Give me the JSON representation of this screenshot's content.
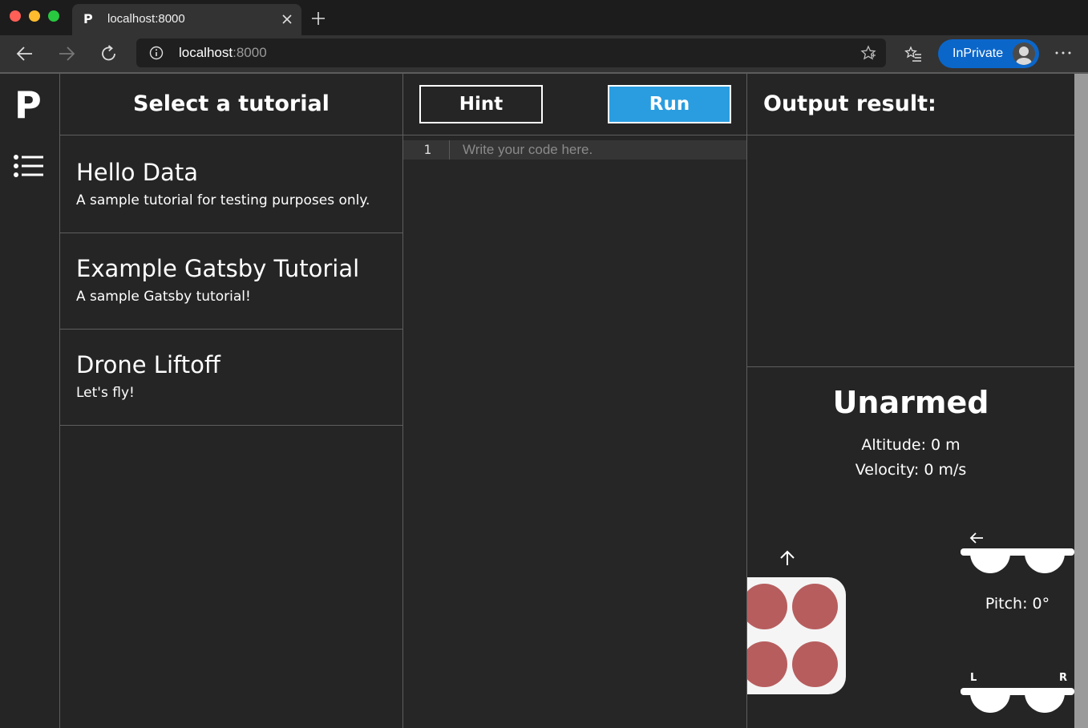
{
  "browser": {
    "tab_title": "localhost:8000",
    "tab_favicon": "P",
    "url_host": "localhost",
    "url_port": ":8000",
    "inprivate_label": "InPrivate"
  },
  "sidebar": {
    "logo": "P"
  },
  "tutorials": {
    "header": "Select a tutorial",
    "items": [
      {
        "name": "Hello Data",
        "description": "A sample tutorial for testing purposes only."
      },
      {
        "name": "Example Gatsby Tutorial",
        "description": "A sample Gatsby tutorial!"
      },
      {
        "name": "Drone Liftoff",
        "description": "Let's fly!"
      }
    ]
  },
  "editor": {
    "hint_label": "Hint",
    "run_label": "Run",
    "line_number": "1",
    "placeholder": "Write your code here."
  },
  "output": {
    "title": "Output result:",
    "status": "Unarmed",
    "altitude": "Altitude: 0 m",
    "velocity": "Velocity: 0 m/s",
    "pitch": "Pitch: 0°",
    "roll_left": "L",
    "roll_right": "R"
  },
  "colors": {
    "run_button": "#2a9de0",
    "rotor": "#b75d5e",
    "inprivate": "#0b66c9"
  }
}
